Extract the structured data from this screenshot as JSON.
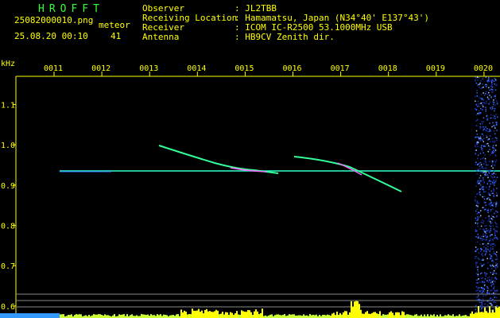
{
  "header": {
    "brand": "HROFFT",
    "filename": "25082000010.png",
    "timestamp": "25.08.20 00:10",
    "counter_label": "meteor",
    "counter_value": "41",
    "info": [
      {
        "key": "Observer",
        "value": ": JL2TBB"
      },
      {
        "key": "Receiving Location",
        "value": ": Hamamatsu, Japan (N34°40' E137°43')"
      },
      {
        "key": "Receiver",
        "value": ": ICOM IC-R2500 53.1000MHz USB"
      },
      {
        "key": "Antenna",
        "value": ": HB9CV Zenith dir."
      }
    ]
  },
  "chart_data": {
    "type": "heatmap",
    "x_tick_labels": [
      "0011",
      "0012",
      "0013",
      "0014",
      "0015",
      "0016",
      "0017",
      "0018",
      "0019",
      "0020"
    ],
    "y_unit_label": "kHz",
    "y_tick_labels": [
      "1.1",
      "1.0",
      "0.9",
      "0.8",
      "0.7",
      "0.6"
    ],
    "y_ticks": [
      1.1,
      1.0,
      0.9,
      0.8,
      0.7,
      0.6
    ],
    "ylim": [
      0.57,
      1.17
    ],
    "carrier_frequency_khz": 0.925,
    "colors": {
      "background": "#000000",
      "text": "#ffff00",
      "brand": "#33ff33",
      "carrier": "#33ffcc",
      "noise": "#3355ff"
    }
  }
}
